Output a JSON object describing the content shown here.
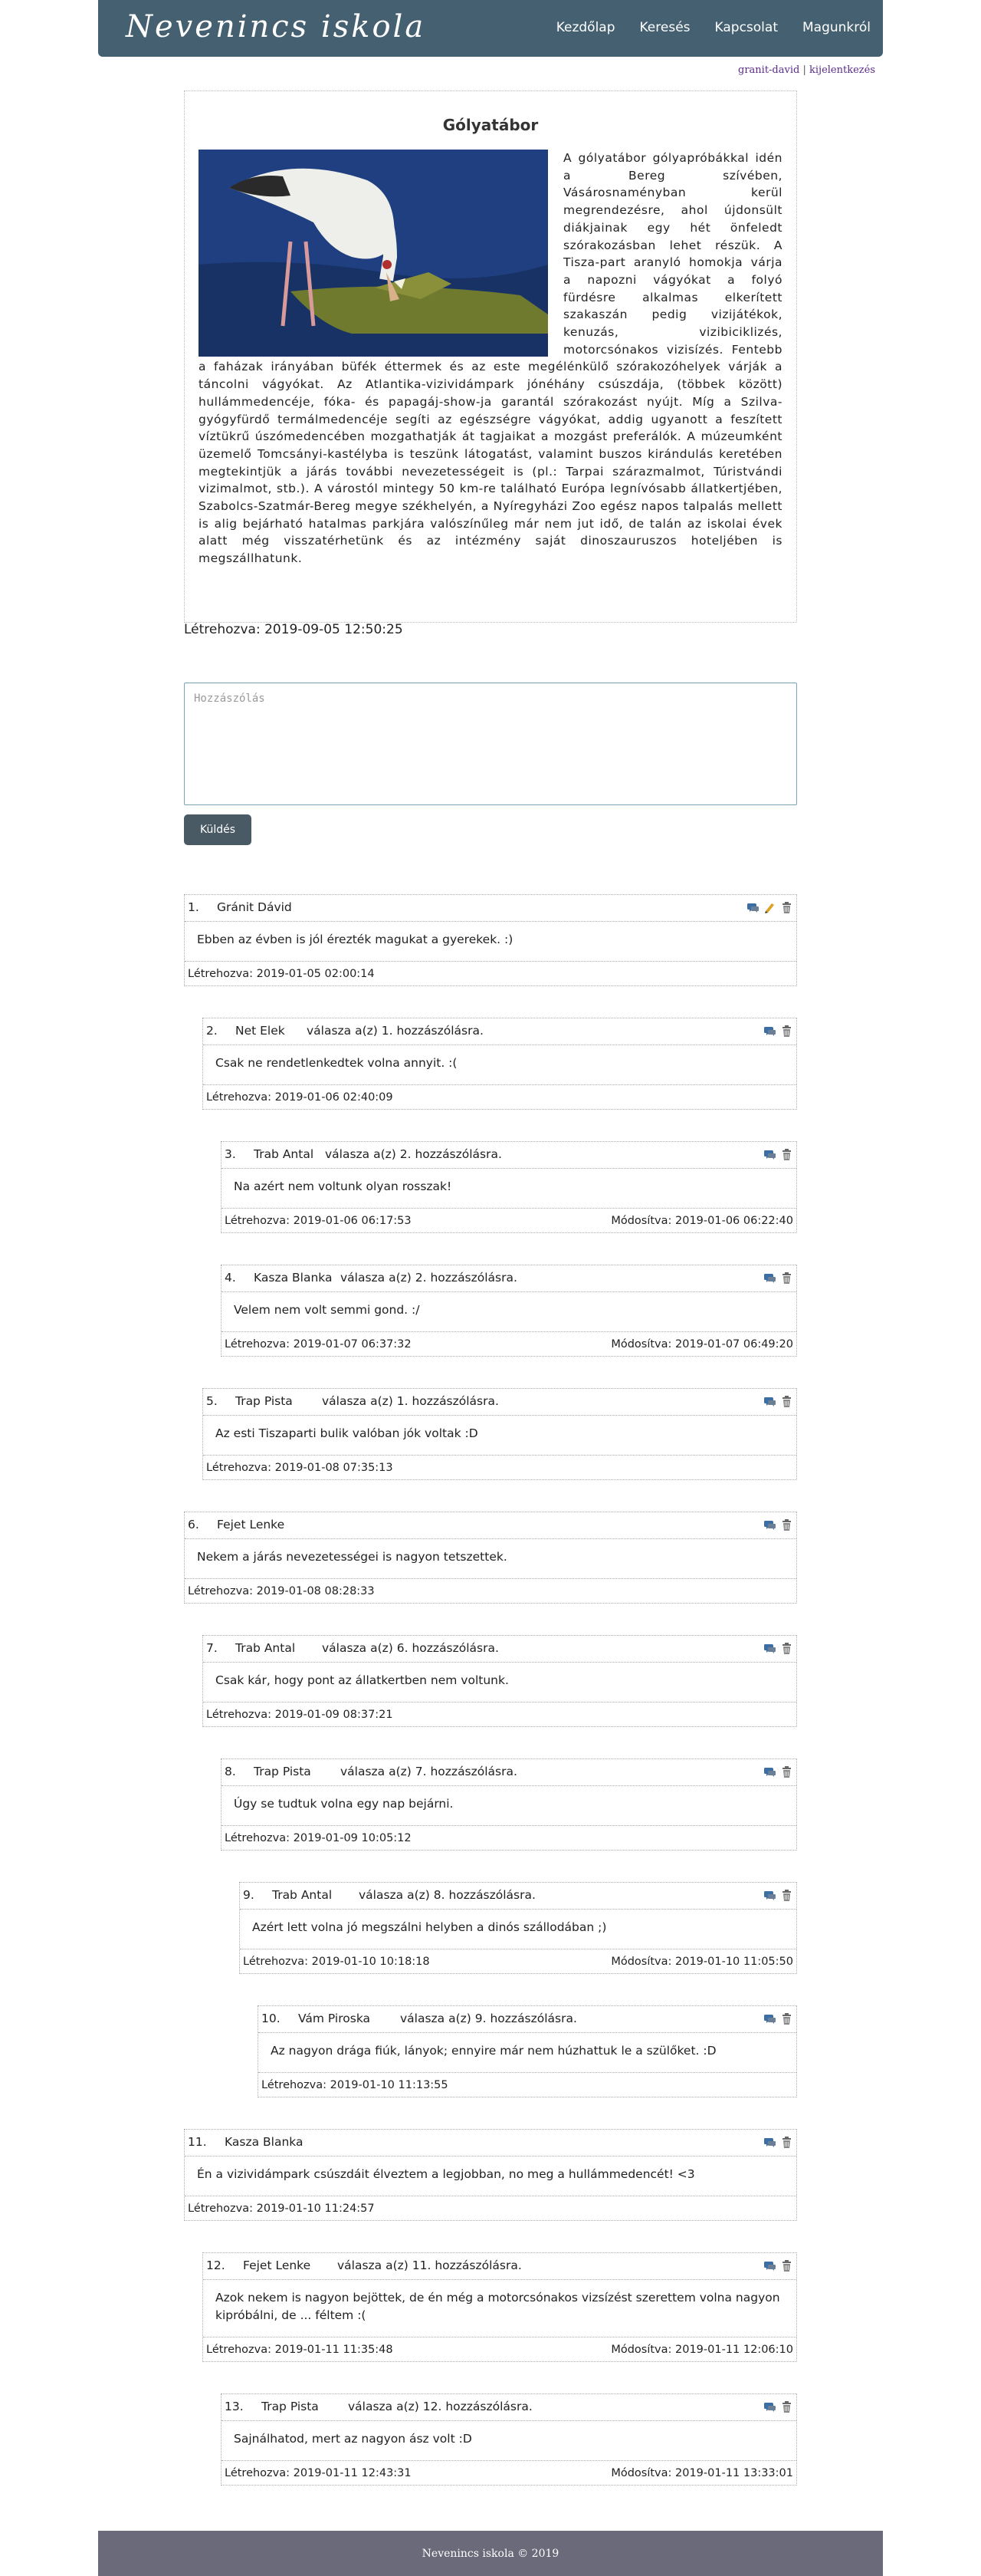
{
  "site": {
    "brand": "Nevenincs iskola"
  },
  "nav": {
    "items": [
      "Kezdőlap",
      "Keresés",
      "Kapcsolat",
      "Magunkról"
    ]
  },
  "user": {
    "name": "granit-david",
    "separator": " | ",
    "logout": "kijelentkezés"
  },
  "article": {
    "title": "Gólyatábor",
    "body": "A gólyatábor gólyapróbákkal idén a Bereg szívében, Vásárosnaményban kerül megrendezésre, ahol újdonsült diákjainak egy hét önfeledt szórakozásban lehet részük. A Tisza-part aranyló homokja várja a napozni vágyókat a folyó fürdésre alkalmas elkerített szakaszán pedig vizijátékok, kenuzás, vizibiciklizés, motorcsónakos vizisízés. Fentebb a faházak irányában büfék éttermek és az este megélénkülő szórakozóhelyek várják a táncolni vágyókat. Az Atlantika-vizividámpark jónéhány csúszdája, (többek között) hullámmedencéje, fóka- és papagáj-show-ja garantál szórakozást nyújt. Míg a Szilva-gyógyfürdő termálmedencéje segíti az egészségre vágyókat, addig ugyanott a feszített víztükrű úszómedencében mozgathatják át tagjaikat a mozgást preferálók. A múzeumként üzemelő Tomcsányi-kastélyba is teszünk látogatást, valamint buszos kirándulás keretében megtekintjük a járás további nevezetességeit is (pl.: Tarpai szárazmalmot, Túristvándi vizimalmot, stb.). A várostól mintegy 50 km-re található Európa legnívósabb állatkertjében, Szabolcs-Szatmár-Bereg megye székhelyén, a Nyíregyházi Zoo egész napos talpalás mellett is alig bejárható hatalmas parkjára valószínűleg már nem jut idő, de talán az iskolai évek alatt még visszatérhetünk és az intézmény saját dinoszauruszos hoteljében is megszállhatunk.",
    "image_alt": "gólya és krokodil",
    "created": "Létrehozva: 2019-09-05 12:50:25"
  },
  "comment_form": {
    "placeholder": "Hozzászólás",
    "submit": "Küldés"
  },
  "comments": [
    {
      "num": "1.",
      "author": "Gránit Dávid",
      "reply": "",
      "text": "Ebben az évben is jól érezték magukat a gyerekek. :)",
      "created": "Létrehozva: 2019-01-05 02:00:14",
      "modified": "",
      "editable": true
    },
    {
      "num": "2.",
      "author": "Net Elek",
      "reply": "válasza a(z) 1. hozzászólásra.",
      "text": "Csak ne rendetlenkedtek volna annyit. :(",
      "created": "Létrehozva: 2019-01-06 02:40:09",
      "modified": ""
    },
    {
      "num": "3.",
      "author": "Trab Antal",
      "reply": "válasza a(z) 2. hozzászólásra.",
      "text": "Na azért nem voltunk olyan rosszak!",
      "created": "Létrehozva: 2019-01-06 06:17:53",
      "modified": "Módosítva: 2019-01-06 06:22:40"
    },
    {
      "num": "4.",
      "author": "Kasza Blanka",
      "reply": "válasza a(z) 2. hozzászólásra.",
      "text": "Velem nem volt semmi gond. :/",
      "created": "Létrehozva: 2019-01-07 06:37:32",
      "modified": "Módosítva: 2019-01-07 06:49:20"
    },
    {
      "num": "5.",
      "author": "Trap Pista",
      "reply": "válasza a(z) 1. hozzászólásra.",
      "text": "Az esti Tiszaparti bulik valóban jók voltak :D",
      "created": "Létrehozva: 2019-01-08 07:35:13",
      "modified": ""
    },
    {
      "num": "6.",
      "author": "Fejet Lenke",
      "reply": "",
      "text": "Nekem a járás nevezetességei is nagyon tetszettek.",
      "created": "Létrehozva: 2019-01-08 08:28:33",
      "modified": ""
    },
    {
      "num": "7.",
      "author": "Trab Antal",
      "reply": "válasza a(z) 6. hozzászólásra.",
      "text": "Csak kár, hogy pont az állatkertben nem voltunk.",
      "created": "Létrehozva: 2019-01-09 08:37:21",
      "modified": ""
    },
    {
      "num": "8.",
      "author": "Trap Pista",
      "reply": "válasza a(z) 7. hozzászólásra.",
      "text": "Úgy se tudtuk volna egy nap bejárni.",
      "created": "Létrehozva: 2019-01-09 10:05:12",
      "modified": ""
    },
    {
      "num": "9.",
      "author": "Trab Antal",
      "reply": "válasza a(z) 8. hozzászólásra.",
      "text": "Azért lett volna jó megszálni helyben a dinós szállodában ;)",
      "created": "Létrehozva: 2019-01-10 10:18:18",
      "modified": "Módosítva: 2019-01-10 11:05:50"
    },
    {
      "num": "10.",
      "author": "Vám Piroska",
      "reply": "válasza a(z) 9. hozzászólásra.",
      "text": "Az nagyon drága fiúk, lányok; ennyire már nem húzhattuk le a szülőket. :D",
      "created": "Létrehozva: 2019-01-10 11:13:55",
      "modified": ""
    },
    {
      "num": "11.",
      "author": "Kasza Blanka",
      "reply": "",
      "text": "Én a vizividámpark csúszdáit élveztem a legjobban, no meg a hullámmedencét! <3",
      "created": "Létrehozva: 2019-01-10 11:24:57",
      "modified": ""
    },
    {
      "num": "12.",
      "author": "Fejet Lenke",
      "reply": "válasza a(z) 11. hozzászólásra.",
      "text": "Azok nekem is nagyon bejöttek, de én még a motorcsónakos vizsízést szerettem volna nagyon kipróbálni, de ... féltem :(",
      "created": "Létrehozva: 2019-01-11 11:35:48",
      "modified": "Módosítva: 2019-01-11 12:06:10"
    },
    {
      "num": "13.",
      "author": "Trap Pista",
      "reply": "válasza a(z) 12. hozzászólásra.",
      "text": "Sajnálhatod, mert az nagyon ász volt :D",
      "created": "Létrehozva: 2019-01-11 12:43:31",
      "modified": "Módosítva: 2019-01-11 13:33:01"
    }
  ],
  "footer": {
    "text": "Nevenincs iskola © 2019"
  }
}
